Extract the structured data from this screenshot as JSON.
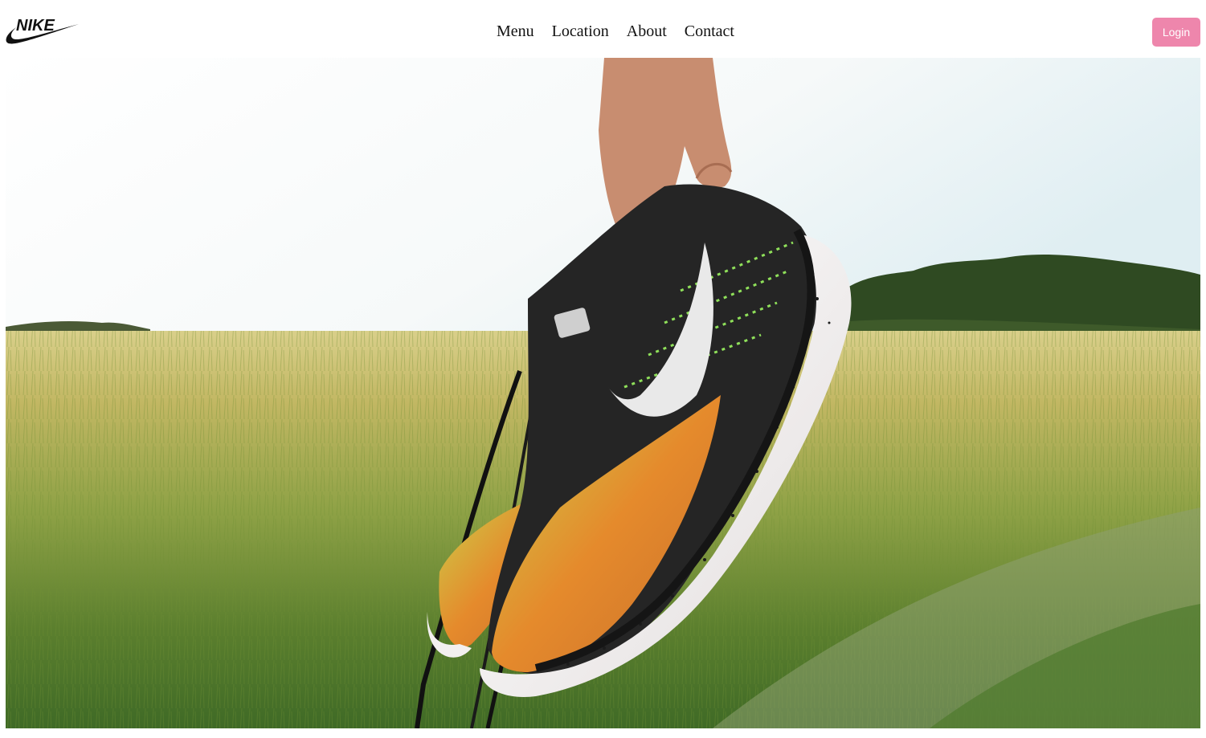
{
  "header": {
    "logo": {
      "icon": "nike-logo-icon",
      "wordmark": "NIKE"
    },
    "nav": [
      {
        "label": "Menu"
      },
      {
        "label": "Location"
      },
      {
        "label": "About"
      },
      {
        "label": "Contact"
      }
    ],
    "login_label": "Login",
    "accent_color": "#ee86ac"
  },
  "hero": {
    "image": "running-shoe-held-over-wheat-field",
    "colors": {
      "sky": "#f4f8f8",
      "field": "#9aa94a",
      "trees": "#2f4a22",
      "shoe_upper": "#222222",
      "shoe_sole": "#f0ecec",
      "shoe_accent": "#e07a2a"
    }
  }
}
